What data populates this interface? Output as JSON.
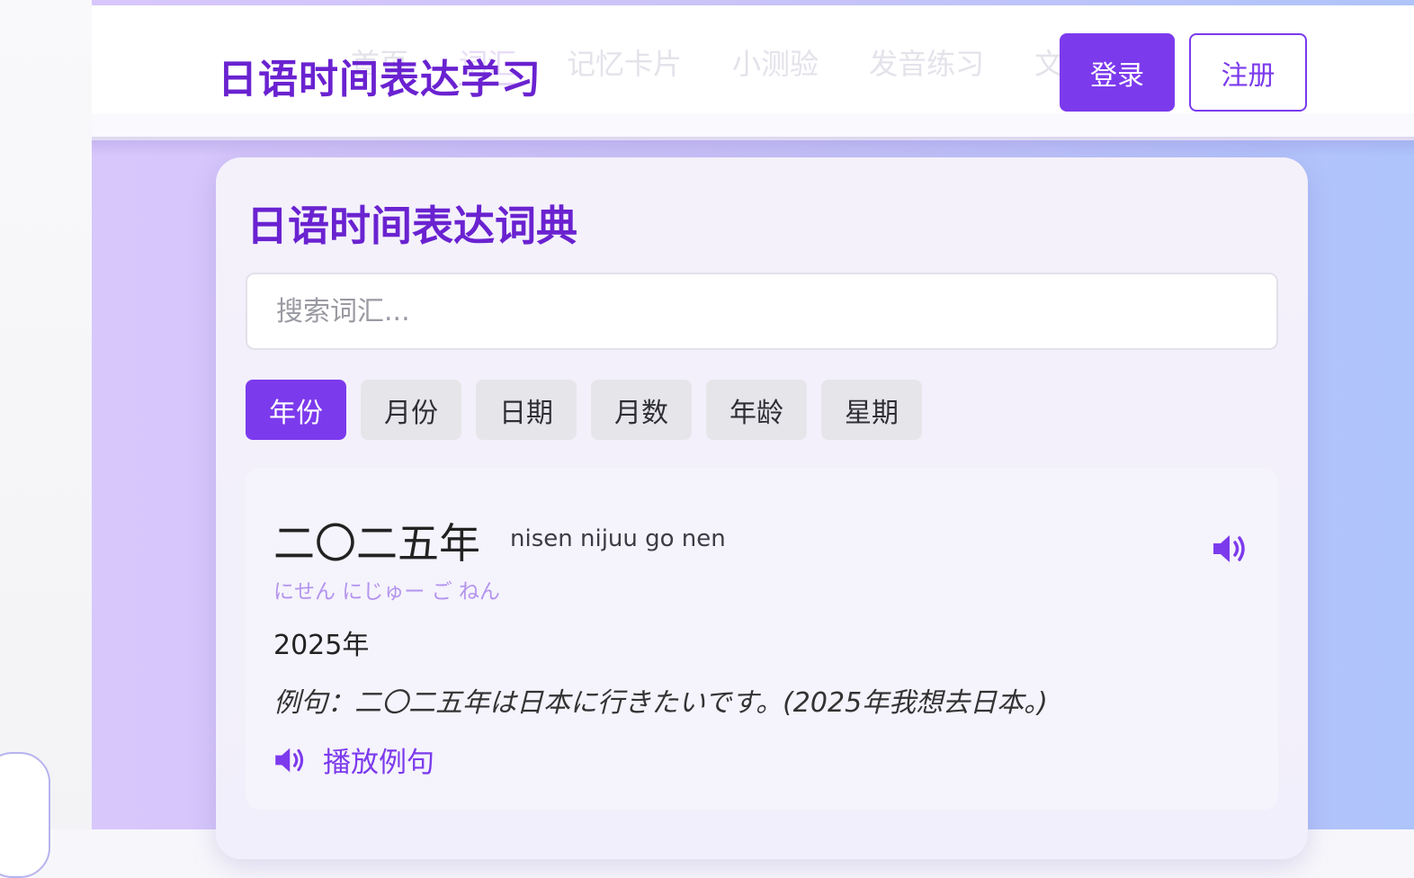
{
  "header": {
    "brand": "日语时间表达学习",
    "nav": [
      {
        "label": "首页"
      },
      {
        "label": "词汇"
      },
      {
        "label": "记忆卡片"
      },
      {
        "label": "小测验"
      },
      {
        "label": "发音练习"
      },
      {
        "label": "文"
      }
    ],
    "login_label": "登录",
    "register_label": "注册"
  },
  "dictionary": {
    "title": "日语时间表达词典",
    "search_placeholder": "搜索词汇...",
    "tabs": [
      {
        "label": "年份",
        "active": true
      },
      {
        "label": "月份",
        "active": false
      },
      {
        "label": "日期",
        "active": false
      },
      {
        "label": "月数",
        "active": false
      },
      {
        "label": "年龄",
        "active": false
      },
      {
        "label": "星期",
        "active": false
      }
    ],
    "entry": {
      "word": "二〇二五年",
      "romaji": "nisen nijuu go nen",
      "kana": "にせん にじゅー ご ねん",
      "meaning": "2025年",
      "example": "例句：二〇二五年は日本に行きたいです。(2025年我想去日本。)",
      "play_example_label": "播放例句"
    }
  },
  "colors": {
    "accent": "#7c3aed",
    "brand_text": "#6a22d0",
    "kana_text": "#b394ee"
  },
  "icons": {
    "speaker": "volume-up-icon"
  }
}
